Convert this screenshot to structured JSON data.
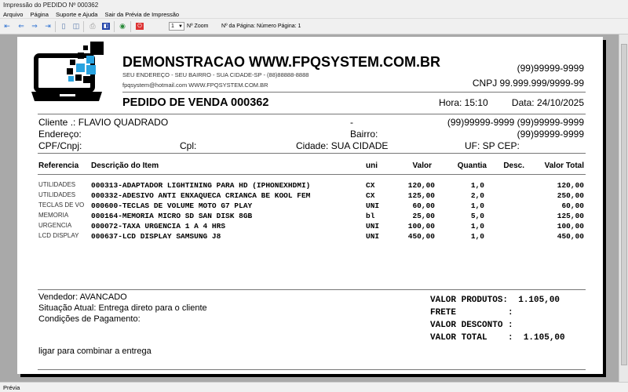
{
  "window": {
    "title": "Impressão do PEDIDO Nº 000362"
  },
  "menu": [
    "Arquivo",
    "Página",
    "Suporte e Ajuda",
    "Sair da Prévia de Impressão"
  ],
  "toolbar": {
    "zoom_value": "1",
    "zoom_label": "Nº Zoom",
    "page_label": "Nº da Página: Número Página: 1"
  },
  "company": {
    "name": "DEMONSTRACAO WWW.FPQSYSTEM.COM.BR",
    "address": "SEU ENDEREÇO - SEU BAIRRO - SUA CIDADE-SP - (88)88888-8888",
    "contact": "fpqsystem@hotmail.com  WWW.FPQSYSTEM.COM.BR",
    "phone": "(99)99999-9999",
    "cnpj": "CNPJ 99.999.999/9999-99"
  },
  "order": {
    "title": "PEDIDO DE VENDA 000362",
    "time": "Hora: 15:10",
    "date": "Data: 24/10/2025"
  },
  "client": {
    "label": "Cliente   .: FLAVIO QUADRADO",
    "dash": "-",
    "phones": "(99)99999-9999  (99)99999-9999",
    "address_label": "Endereço:",
    "bairro_label": "Bairro:",
    "phone2": "(99)99999-9999",
    "cpf_label": "CPF/Cnpj:",
    "cpl_label": "Cpl:",
    "city": "Cidade: SUA CIDADE",
    "uf": "UF: SP  CEP:"
  },
  "table": {
    "headers": [
      "Referencia",
      "Descrição do Item",
      "uni",
      "Valor",
      "Quantia",
      "Desc.",
      "Valor Total"
    ],
    "rows": [
      [
        "UTILIDADES",
        "000313-ADAPTADOR LIGHTINING PARA HD (IPHONEXHDMI)",
        "CX",
        "120,00",
        "1,0",
        "",
        "120,00"
      ],
      [
        "UTILIDADES",
        "000332-ADESIVO ANTI ENXAQUECA CRIANCA BE KOOL FEM",
        "CX",
        "125,00",
        "2,0",
        "",
        "250,00"
      ],
      [
        "TECLAS DE VO",
        "000600-TECLAS DE VOLUME MOTO G7 PLAY",
        "UNI",
        "60,00",
        "1,0",
        "",
        "60,00"
      ],
      [
        "MEMORIA",
        "000164-MEMORIA MICRO SD SAN DISK 8GB",
        "bl",
        "25,00",
        "5,0",
        "",
        "125,00"
      ],
      [
        "URGENCIA",
        "000072-TAXA URGENCIA 1 A 4 HRS",
        "UNI",
        "100,00",
        "1,0",
        "",
        "100,00"
      ],
      [
        "LCD DISPLAY",
        "000637-LCD DISPLAY SAMSUNG J8",
        "UNI",
        "450,00",
        "1,0",
        "",
        "450,00"
      ]
    ]
  },
  "footer": {
    "seller": "Vendedor: AVANCADO",
    "situation": "Situação Atual: Entrega direto para o cliente",
    "payment": "Condições de Pagamento:",
    "note": "ligar para combinar a entrega",
    "totals": [
      "VALOR PRODUTOS:  1.105,00",
      "FRETE          :",
      "VALOR DESCONTO :",
      "VALOR TOTAL    :  1.105,00"
    ]
  },
  "statusbar": "Prévia"
}
